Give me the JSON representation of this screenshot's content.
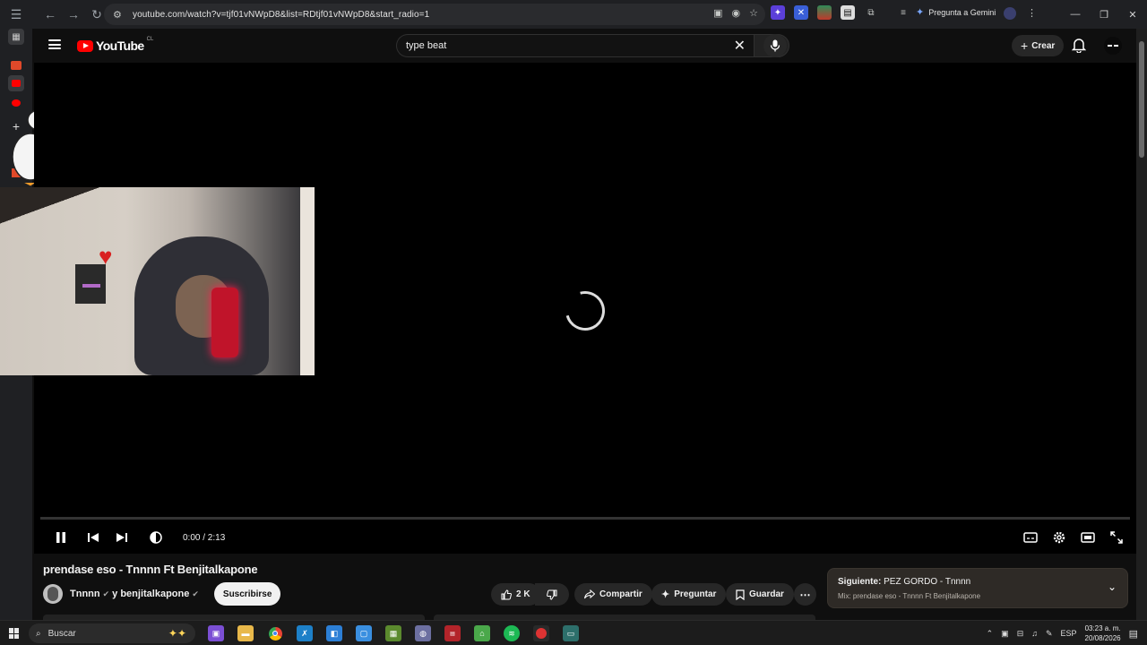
{
  "browser": {
    "url": "youtube.com/watch?v=tjf01vNWpD8&list=RDtjf01vNWpD8&start_radio=1",
    "gemini_label": "Pregunta a Gemini"
  },
  "youtube": {
    "logo_text": "YouTube",
    "logo_country": "CL",
    "search_query": "type beat",
    "create_label": "Crear"
  },
  "player": {
    "time_display": "0:00 / 2:13",
    "progress_fraction": 0.0
  },
  "video": {
    "title": "prendase eso - Tnnnn Ft Benjitalkapone",
    "channel_primary": "Tnnnn",
    "channel_joiner": "y benjitalkapone",
    "subscribe_label": "Suscribirse",
    "likes": "2 K",
    "share_label": "Compartir",
    "ask_label": "Preguntar",
    "save_label": "Guardar"
  },
  "up_next": {
    "prefix": "Siguiente:",
    "title": "PEZ GORDO - Tnnnn",
    "subtitle": "Mix: prendase eso - Tnnnn Ft Benjitalkapone"
  },
  "taskbar": {
    "search_placeholder": "Buscar",
    "language": "ESP",
    "time": "03:23 a. m.",
    "date": "20/08/2026"
  },
  "colors": {
    "brand_red": "#ff0000",
    "background": "#0f0f0f",
    "pill": "#272727"
  }
}
